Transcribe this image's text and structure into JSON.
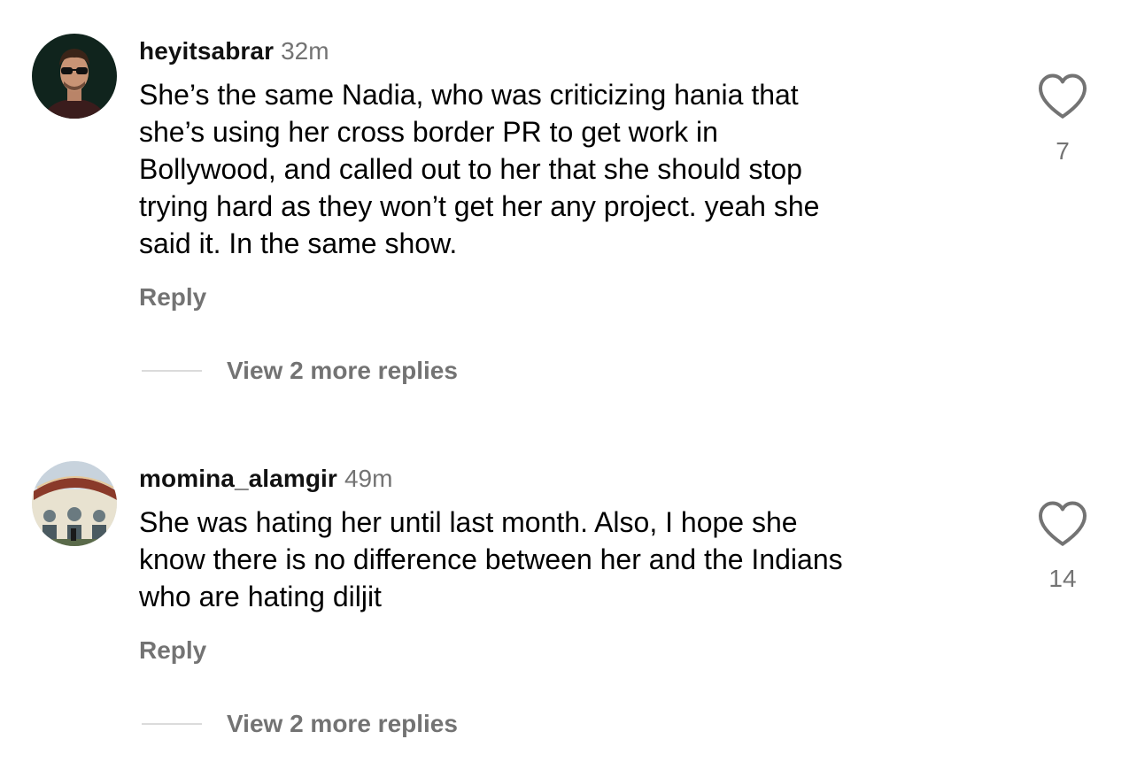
{
  "comments": [
    {
      "username": "heyitsabrar",
      "time": "32m",
      "lines": [
        "She’s the same Nadia, who was criticizing hania that",
        "she’s using her cross border PR to get work in",
        "Bollywood, and called out to her that she should stop",
        "trying hard as they won’t get her any project. yeah she",
        "said it. In the same show."
      ],
      "reply_label": "Reply",
      "more_replies_label": "View 2 more replies",
      "likes": "7",
      "avatar_icon": "person-sunglasses-avatar"
    },
    {
      "username": "momina_alamgir",
      "time": "49m",
      "lines": [
        "She was hating her until last month. Also, I hope she",
        "know there is no difference between her and the Indians",
        "who are hating diljit"
      ],
      "reply_label": "Reply",
      "more_replies_label": "View 2 more replies",
      "likes": "14",
      "avatar_icon": "building-photo-avatar"
    }
  ],
  "colors": {
    "text": "#000000",
    "username": "#111111",
    "secondary": "#737373",
    "divider": "#dbdbdb"
  }
}
